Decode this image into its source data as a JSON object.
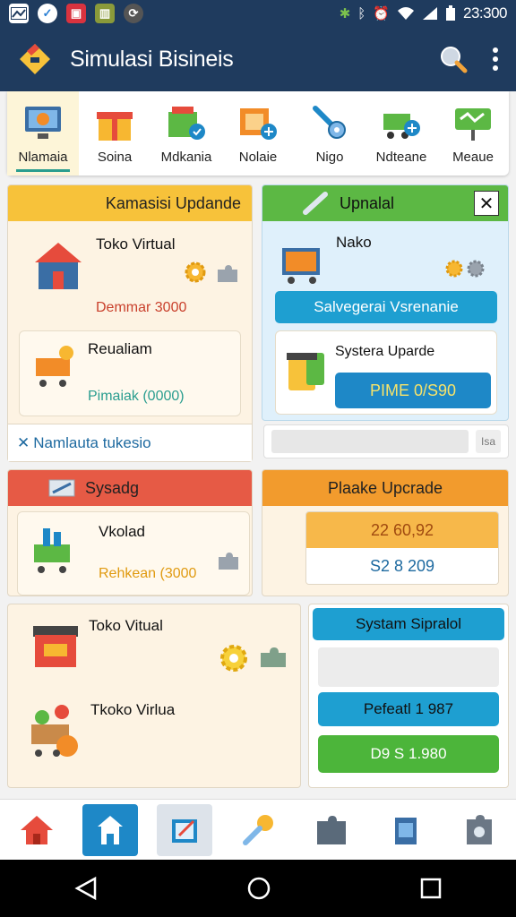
{
  "status": {
    "time": "23:300"
  },
  "header": {
    "title": "Simulasi Bisineis"
  },
  "tabs": [
    {
      "label": "Nlamaia",
      "icon": "computer-icon"
    },
    {
      "label": "Soina",
      "icon": "gift-box-icon"
    },
    {
      "label": "Mdkania",
      "icon": "box-check-icon"
    },
    {
      "label": "Nolaie",
      "icon": "crate-add-icon"
    },
    {
      "label": "Nigo",
      "icon": "wrench-gear-icon"
    },
    {
      "label": "Ndteane",
      "icon": "cart-add-icon"
    },
    {
      "label": "Meaue",
      "icon": "sign-icon"
    }
  ],
  "panel_upgrade": {
    "title": "Kamasisi Updande",
    "card1": {
      "title": "Toko Virtual",
      "sub": "Demmar 3000"
    },
    "card2": {
      "title": "Reualiam",
      "sub": "Pimaiak (0000)"
    },
    "footer": "Namlauta tukesio"
  },
  "panel_upnalal": {
    "title": "Upnalal",
    "card_title": "Nako",
    "button1": "Salvegerai Vsrenanie",
    "card2_title": "Systera Uparde",
    "button2": "PIME 0/S90",
    "input_suffix": "Isa"
  },
  "panel_sysadg": {
    "title": "Sysadg",
    "card_title": "Vkolad",
    "card_sub": "Rehkean (3000"
  },
  "panel_plaake": {
    "title": "Plaake Upcrade",
    "value1": "22 60,92",
    "value2": "S2 8 209"
  },
  "panel_bottom_left": {
    "item1": "Toko Vitual",
    "item2": "Tkoko Virlua"
  },
  "panel_bottom_right": {
    "title": "Systam Sipralol",
    "button1": "Pefeatl 1 987",
    "button2": "D9 S 1.980"
  },
  "colors": {
    "appbar": "#1f3b5e",
    "yellow_head": "#f7c23a",
    "green_head": "#5cb844",
    "red_head": "#e65a45",
    "orange_head": "#f29b2d",
    "blue_button": "#1e88c7",
    "green_button": "#4cb53a"
  }
}
